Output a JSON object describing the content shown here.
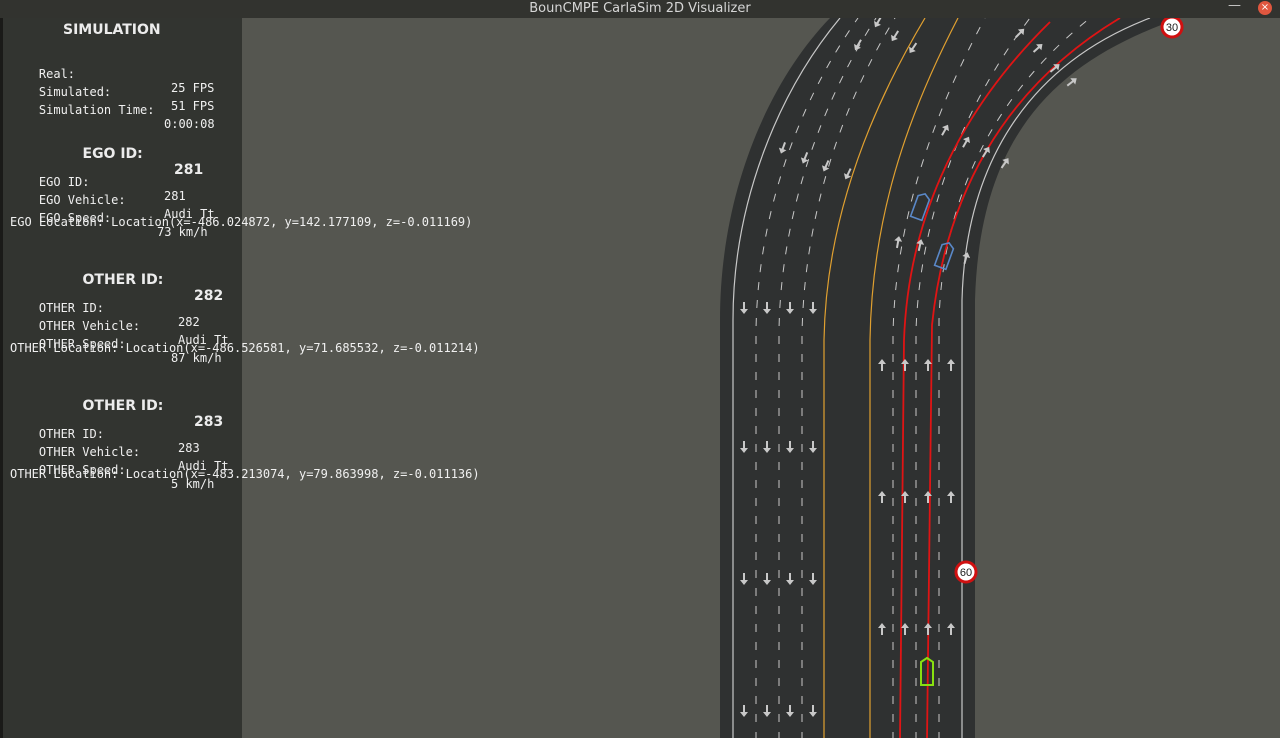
{
  "window": {
    "title": "BounCMPE CarlaSim 2D Visualizer",
    "minimize_glyph": "—",
    "close_glyph": "×",
    "close_color": "#e0573f"
  },
  "hud": {
    "simulation": {
      "title": "SIMULATION",
      "real_label": "Real:",
      "real_value": "25 FPS",
      "simulated_label": "Simulated:",
      "simulated_value": "51 FPS",
      "time_label": "Simulation Time:",
      "time_value": "0:00:08"
    },
    "ego": {
      "title": "EGO ID:",
      "title_value": "281",
      "id_label": "EGO ID:",
      "id_value": "281",
      "vehicle_label": "EGO Vehicle:",
      "vehicle_value": "Audi Tt",
      "speed_label": "EGO Speed:",
      "speed_value": "73 km/h",
      "location": "EGO Location: Location(x=-486.024872, y=142.177109, z=-0.011169)"
    },
    "others": [
      {
        "title": "OTHER ID:",
        "title_value": "282",
        "id_label": "OTHER ID:",
        "id_value": "282",
        "vehicle_label": "OTHER Vehicle:",
        "vehicle_value": "Audi Tt",
        "speed_label": "OTHER Speed:",
        "speed_value": "87 km/h",
        "location": "OTHER Location: Location(x=-486.526581, y=71.685532, z=-0.011214)"
      },
      {
        "title": "OTHER ID:",
        "title_value": "283",
        "id_label": "OTHER ID:",
        "id_value": "283",
        "vehicle_label": "OTHER Vehicle:",
        "vehicle_value": "Audi Tt",
        "speed_label": "OTHER Speed:",
        "speed_value": "5 km/h",
        "location": "OTHER Location: Location(x=-483.213074, y=79.863998, z=-0.011136)"
      }
    ]
  },
  "map": {
    "speed_signs": [
      "30",
      "60"
    ],
    "colors": {
      "background": "#555650",
      "road": "#2f3131",
      "lane_line": "#c8c8c8",
      "center_line": "#e0a030",
      "route": "#e01414",
      "ego_vehicle": "#88e010",
      "other_vehicle": "#5a88c8",
      "sign_border": "#d01010"
    }
  }
}
